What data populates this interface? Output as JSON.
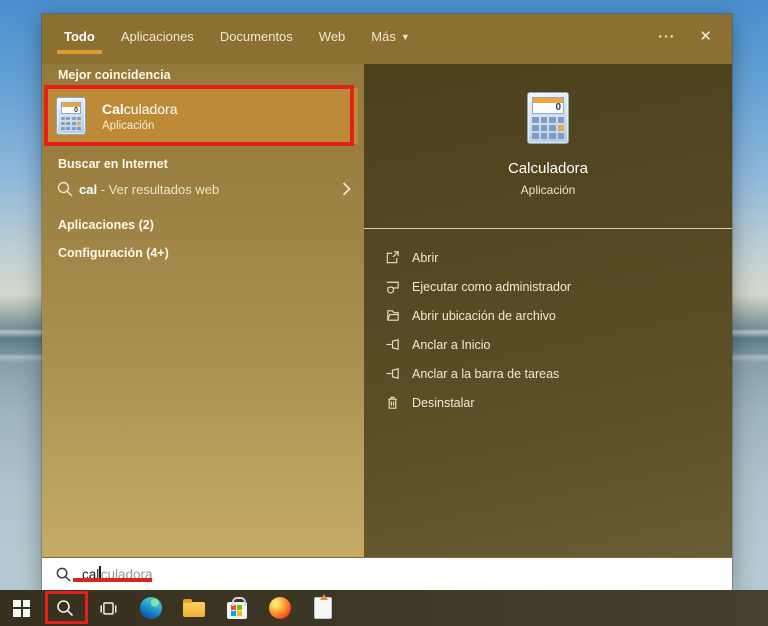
{
  "tabbar": {
    "tabs": [
      {
        "label": "Todo",
        "active": true
      },
      {
        "label": "Aplicaciones",
        "active": false
      },
      {
        "label": "Documentos",
        "active": false
      },
      {
        "label": "Web",
        "active": false
      },
      {
        "label": "Más",
        "active": false,
        "caret": "▼"
      }
    ],
    "ellipsis_label": "···",
    "close_label": "✕"
  },
  "left_panel": {
    "best_match_header": "Mejor coincidencia",
    "best_match": {
      "title_match": "Cal",
      "title_rest": "culadora",
      "subtitle": "Aplicación"
    },
    "web_header": "Buscar en Internet",
    "web_row": {
      "query_match": "cal",
      "suffix": " - Ver resultados web"
    },
    "apps_group_label": "Aplicaciones (2)",
    "settings_group_label": "Configuración (4+)"
  },
  "right_panel": {
    "app_title": "Calculadora",
    "app_subtitle": "Aplicación",
    "calc_display": "0",
    "actions": [
      {
        "icon": "open-icon",
        "label": "Abrir"
      },
      {
        "icon": "run-as-admin-icon",
        "label": "Ejecutar como administrador"
      },
      {
        "icon": "file-location-icon",
        "label": "Abrir ubicación de archivo"
      },
      {
        "icon": "pin-to-start-icon",
        "label": "Anclar a Inicio"
      },
      {
        "icon": "pin-to-taskbar-icon",
        "label": "Anclar a la barra de tareas"
      },
      {
        "icon": "uninstall-icon",
        "label": "Desinstalar"
      }
    ]
  },
  "search_bar": {
    "typed": "cal",
    "suggestion": "culadora"
  },
  "colors": {
    "accent": "#e09b2d",
    "annotation_red": "#e3201c",
    "selected_row": "#bd8b37"
  }
}
